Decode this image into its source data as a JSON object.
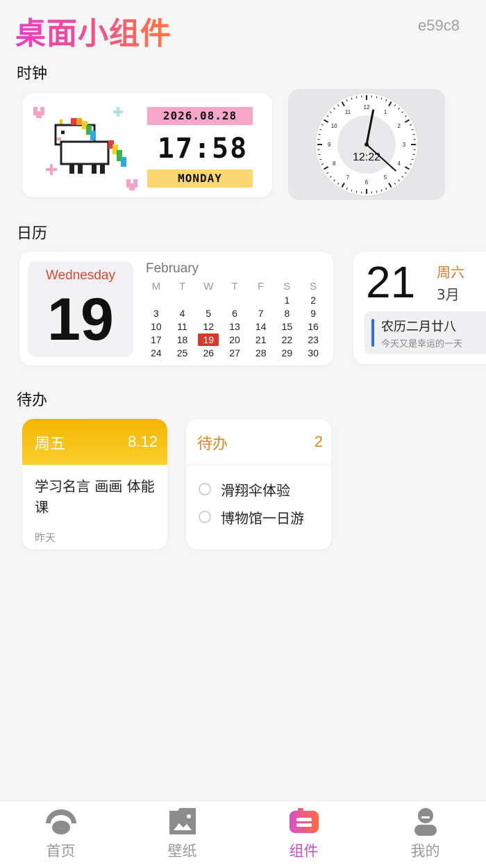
{
  "header": {
    "title": "桌面小组件",
    "user_id": "e59c8"
  },
  "sections": {
    "clock": "时钟",
    "calendar": "日历",
    "todo": "待办"
  },
  "pixel_clock": {
    "date": "2026.08.28",
    "time": "17:58",
    "day": "MONDAY"
  },
  "analog_clock": {
    "digital": "12:22",
    "numerals": [
      "12",
      "1",
      "2",
      "3",
      "4",
      "5",
      "6",
      "7",
      "8",
      "9",
      "10",
      "11"
    ],
    "hour": 12,
    "minute": 22
  },
  "month_calendar": {
    "weekday": "Wednesday",
    "day": "19",
    "month": "February",
    "headers": [
      "M",
      "T",
      "W",
      "T",
      "F",
      "S",
      "S"
    ],
    "weeks": [
      [
        "",
        "",
        "",
        "",
        "",
        "1",
        "2"
      ],
      [
        "3",
        "4",
        "5",
        "6",
        "7",
        "8",
        "9"
      ],
      [
        "10",
        "11",
        "12",
        "13",
        "14",
        "15",
        "16"
      ],
      [
        "17",
        "18",
        "19",
        "20",
        "21",
        "22",
        "23"
      ],
      [
        "24",
        "25",
        "26",
        "27",
        "28",
        "29",
        "30"
      ]
    ],
    "today": "19"
  },
  "date_card": {
    "day": "21",
    "weekday": "周六",
    "month": "3月",
    "lunar": "农历二月廿八",
    "subtitle": "今天又是幸运的一天"
  },
  "note_card": {
    "weekday": "周五",
    "date": "8.12",
    "text": "学习名言 画画 体能课",
    "time": "昨天"
  },
  "todo_card": {
    "title": "待办",
    "count": "2",
    "items": [
      {
        "label": "滑翔伞体验"
      },
      {
        "label": "博物馆一日游"
      }
    ]
  },
  "nav": {
    "items": [
      {
        "label": "首页",
        "icon": "home-dome-icon"
      },
      {
        "label": "壁纸",
        "icon": "wallpaper-icon"
      },
      {
        "label": "组件",
        "icon": "widget-icon"
      },
      {
        "label": "我的",
        "icon": "profile-icon"
      }
    ],
    "active": "组件"
  },
  "colors": {
    "accent_pink": "#ec3fc6",
    "accent_orange": "#ff7a3a",
    "active_nav": "#c94dc2",
    "today_red": "#d8382c",
    "note_yellow": "#f5b400",
    "todo_orange": "#e08322"
  }
}
